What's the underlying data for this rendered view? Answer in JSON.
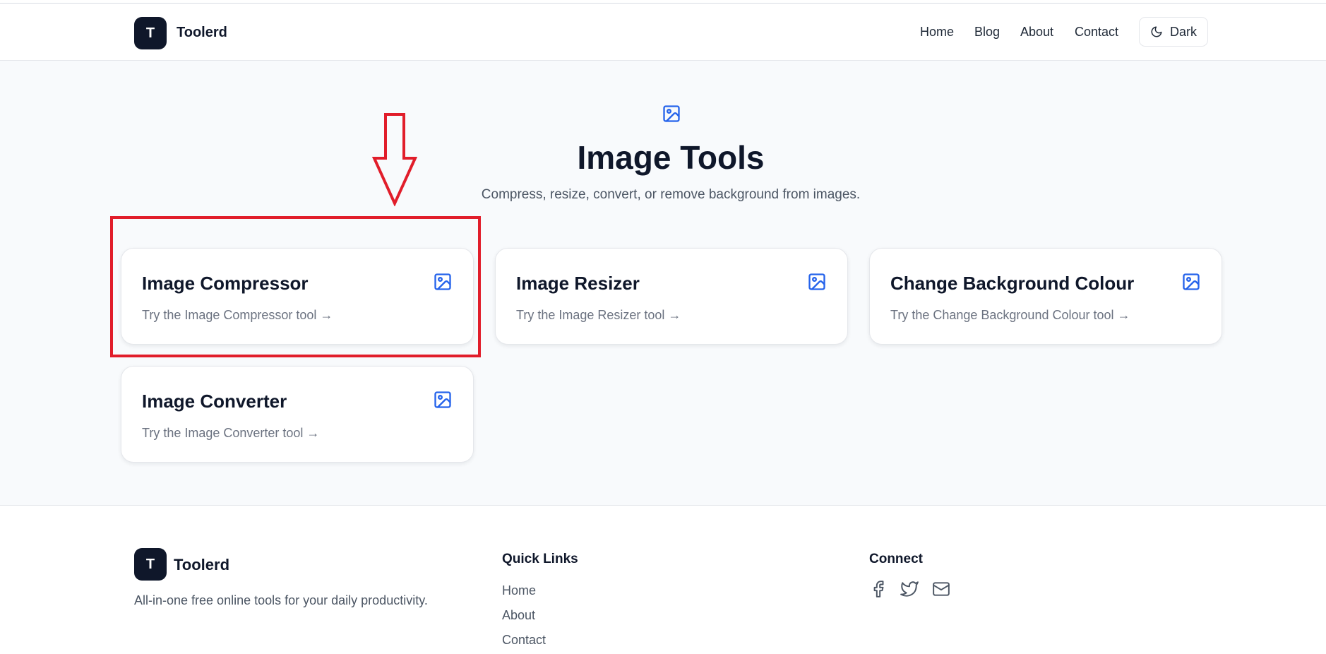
{
  "header": {
    "logo_letter": "T",
    "brand": "Toolerd",
    "nav": [
      {
        "label": "Home"
      },
      {
        "label": "Blog"
      },
      {
        "label": "About"
      },
      {
        "label": "Contact"
      }
    ],
    "theme_toggle": {
      "label": "Dark",
      "icon": "moon-icon"
    }
  },
  "hero": {
    "icon": "image-icon",
    "title": "Image Tools",
    "subtitle": "Compress, resize, convert, or remove background from images."
  },
  "tools": [
    {
      "title": "Image Compressor",
      "desc": "Try the Image Compressor tool →",
      "icon": "image-icon"
    },
    {
      "title": "Image Resizer",
      "desc": "Try the Image Resizer tool →",
      "icon": "image-icon"
    },
    {
      "title": "Change Background Colour",
      "desc": "Try the Change Background Colour tool →",
      "icon": "image-icon"
    },
    {
      "title": "Image Converter",
      "desc": "Try the Image Converter tool →",
      "icon": "image-icon"
    }
  ],
  "annotation": {
    "color": "#e11d2a",
    "highlighted_tool": "Image Compressor"
  },
  "footer": {
    "logo_letter": "T",
    "brand": "Toolerd",
    "tagline": "All-in-one free online tools for your daily productivity.",
    "quick_links": {
      "heading": "Quick Links",
      "items": [
        {
          "label": "Home"
        },
        {
          "label": "About"
        },
        {
          "label": "Contact"
        }
      ]
    },
    "connect": {
      "heading": "Connect",
      "icons": [
        "facebook-icon",
        "twitter-icon",
        "mail-icon"
      ]
    }
  },
  "colors": {
    "accent": "#2563eb",
    "dark": "#0f172a",
    "background": "#f8fafc"
  }
}
